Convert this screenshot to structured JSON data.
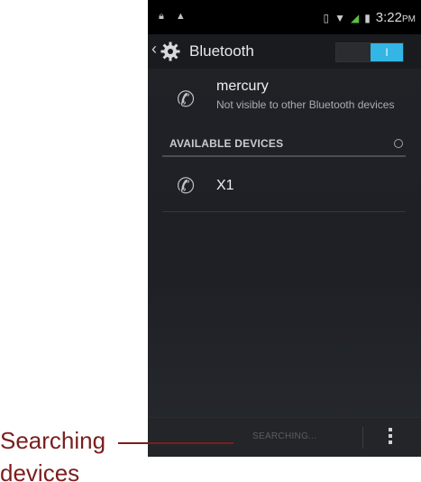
{
  "statusbar": {
    "left_icons": [
      "lock-icon",
      "warning-icon"
    ],
    "right_icons": [
      "vibrate-icon",
      "wifi-icon",
      "signal-icon",
      "battery-icon"
    ],
    "time": "3:22",
    "ampm": "PM"
  },
  "actionbar": {
    "title": "Bluetooth",
    "toggle_on_label": "I"
  },
  "self_device": {
    "name": "mercury",
    "subtitle": "Not visible to other Bluetooth devices"
  },
  "available": {
    "header": "AVAILABLE DEVICES",
    "devices": [
      {
        "name": "X1"
      }
    ]
  },
  "bottombar": {
    "searching_label": "SEARCHING..."
  },
  "annotation": {
    "line1": "Searching",
    "line2": "devices"
  },
  "colors": {
    "accent": "#33b5e5",
    "annotation": "#7a1e1e"
  }
}
